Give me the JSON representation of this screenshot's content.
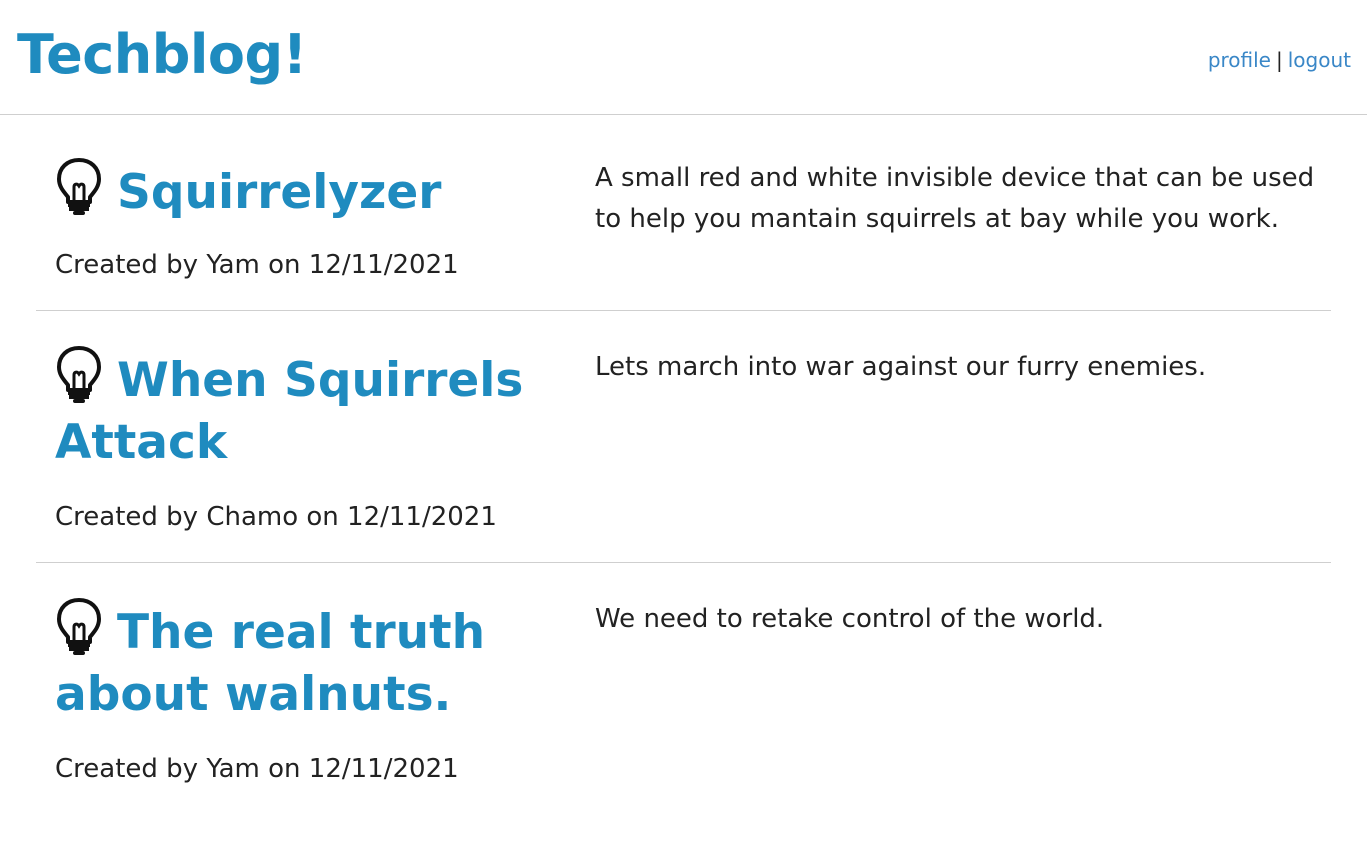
{
  "header": {
    "title": "Techblog!",
    "nav": {
      "profile_label": "profile",
      "separator": "|",
      "logout_label": "logout"
    }
  },
  "posts": [
    {
      "icon": "lightbulb-icon",
      "title": "Squirrelyzer",
      "meta": "Created by Yam on 12/11/2021",
      "body": "A small red and white invisible device that can be used to help you mantain squirrels at bay while you work."
    },
    {
      "icon": "lightbulb-icon",
      "title": "When Squirrels Attack",
      "meta": "Created by Chamo on 12/11/2021",
      "body": "Lets march into war against our furry enemies."
    },
    {
      "icon": "lightbulb-icon",
      "title": "The real truth about walnuts.",
      "meta": "Created by Yam on 12/11/2021",
      "body": "We need to retake control of the world."
    }
  ],
  "colors": {
    "accent": "#1f8bbf",
    "link": "#3a87c7",
    "text": "#222222",
    "divider": "#cfcfcf"
  }
}
